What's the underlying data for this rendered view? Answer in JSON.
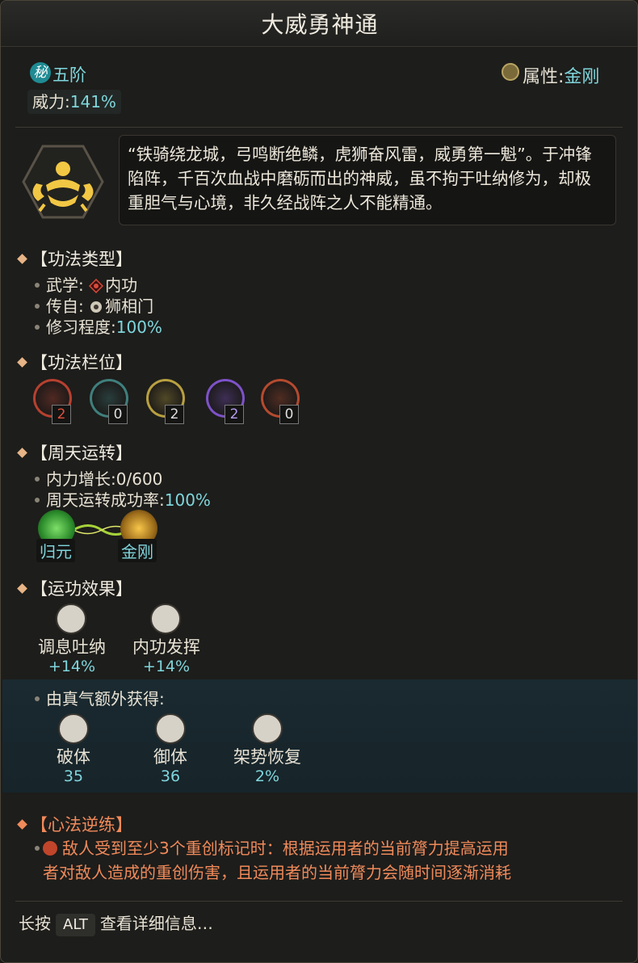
{
  "title": "大威勇神通",
  "rank": {
    "badge": "秘",
    "text": "五阶"
  },
  "power": {
    "label": "威力:",
    "value": "141%"
  },
  "attribute": {
    "label": "属性:",
    "value": "金刚"
  },
  "description": "“铁骑绕龙城，弓鸣断绝鳞，虎狮奋风雷，威勇第一魁”。于冲锋陷阵，千百次血战中磨砺而出的神威，虽不拘于吐纳修为，却极重胆气与心境，非久经战阵之人不能精通。",
  "type_section": {
    "heading": "【功法类型】",
    "items": [
      {
        "label": "武学:",
        "value": "内功",
        "icon": "neigong-icon"
      },
      {
        "label": "传自:",
        "value": "狮相门",
        "icon": "lion-sect-icon"
      },
      {
        "label": "修习程度:",
        "value": "100%"
      }
    ]
  },
  "slot_section": {
    "heading": "【功法栏位】",
    "slots": [
      {
        "count": "2",
        "color": "#b7402f"
      },
      {
        "count": "0",
        "color": "#3f7f7c"
      },
      {
        "count": "2",
        "color": "#b8a040"
      },
      {
        "count": "2",
        "color": "#7d52c8"
      },
      {
        "count": "0",
        "color": "#b44a2f"
      }
    ]
  },
  "cycle_section": {
    "heading": "【周天运转】",
    "items": [
      {
        "label": "内力增长:",
        "value": "0/600"
      },
      {
        "label": "周天运转成功率:",
        "value": "100%"
      }
    ],
    "nodes": [
      "归元",
      "金刚"
    ]
  },
  "effect_section": {
    "heading": "【运功效果】",
    "effects": [
      {
        "label": "调息吐纳",
        "value": "+14%"
      },
      {
        "label": "内功发挥",
        "value": "+14%"
      }
    ],
    "zhenqi_label": "由真气额外获得:",
    "zhenqi": [
      {
        "label": "破体",
        "value": "35"
      },
      {
        "label": "御体",
        "value": "36"
      },
      {
        "label": "架势恢复",
        "value": "2%"
      }
    ]
  },
  "revert_section": {
    "heading": "【心法逆练】",
    "text_line1": "敌人受到至少3个重创标记时：根据运用者的当前膂力提高运用",
    "text_line2": "者对敌人造成的重创伤害，且运用者的当前膂力会随时间逐渐消耗"
  },
  "footer": {
    "prefix": "长按",
    "key": "ALT",
    "suffix": "查看详细信息…"
  }
}
